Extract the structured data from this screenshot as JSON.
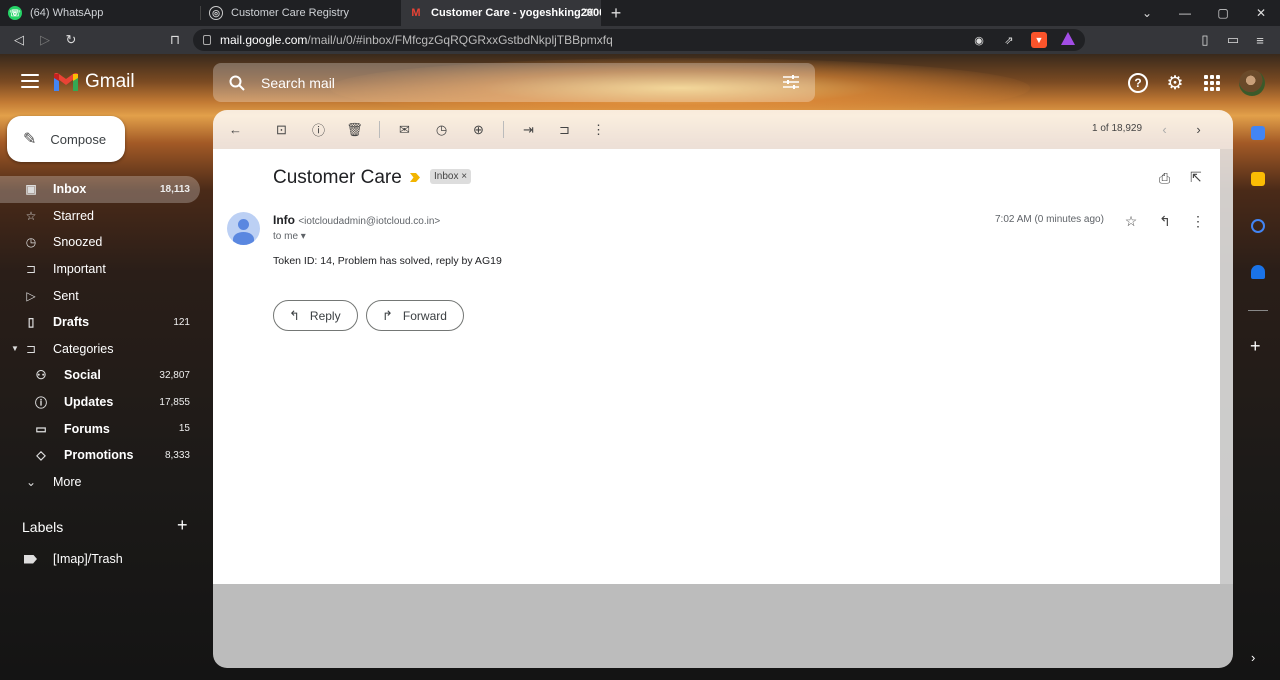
{
  "browser": {
    "tabs": [
      {
        "title": "(64) WhatsApp",
        "favicon": "whatsapp-icon",
        "active": false
      },
      {
        "title": "Customer Care Registry",
        "favicon": "globe-icon",
        "active": false
      },
      {
        "title": "Customer Care - yogeshking2000",
        "favicon": "gmail-icon",
        "active": true
      }
    ],
    "new_tab": "+",
    "url_host": "mail.google.com",
    "url_path": "/mail/u/0/#inbox/FMfcgzGqRQGRxxGstbdNkpljTBBpmxfq"
  },
  "gmail": {
    "logo_text": "Gmail",
    "search_placeholder": "Search mail",
    "compose_label": "Compose",
    "nav": [
      {
        "label": "Inbox",
        "count": "18,113",
        "icon": "inbox-icon"
      },
      {
        "label": "Starred",
        "count": "",
        "icon": "star-icon"
      },
      {
        "label": "Snoozed",
        "count": "",
        "icon": "clock-icon"
      },
      {
        "label": "Important",
        "count": "",
        "icon": "important-icon"
      },
      {
        "label": "Sent",
        "count": "",
        "icon": "send-icon"
      },
      {
        "label": "Drafts",
        "count": "121",
        "icon": "draft-icon"
      },
      {
        "label": "Categories",
        "count": "",
        "icon": "label-icon"
      },
      {
        "label": "Social",
        "count": "32,807",
        "icon": "people-icon"
      },
      {
        "label": "Updates",
        "count": "17,855",
        "icon": "info-icon"
      },
      {
        "label": "Forums",
        "count": "15",
        "icon": "forum-icon"
      },
      {
        "label": "Promotions",
        "count": "8,333",
        "icon": "tag-icon"
      },
      {
        "label": "More",
        "count": "",
        "icon": "chevron-down-icon"
      }
    ],
    "labels_heading": "Labels",
    "labels": [
      {
        "label": "[Imap]/Trash"
      }
    ],
    "pager": "1 of 18,929",
    "email": {
      "subject": "Customer Care",
      "chip": "Inbox",
      "sender_name": "Info",
      "sender_email": "<iotcloudadmin@iotcloud.co.in>",
      "to": "to me",
      "time": "7:02 AM (0 minutes ago)",
      "body": "Token ID: 14, Problem has solved, reply by AG19",
      "reply_label": "Reply",
      "forward_label": "Forward"
    }
  },
  "colors": {
    "accent_yellow": "#f2b400",
    "avatar_blue": "#5a87e0"
  }
}
